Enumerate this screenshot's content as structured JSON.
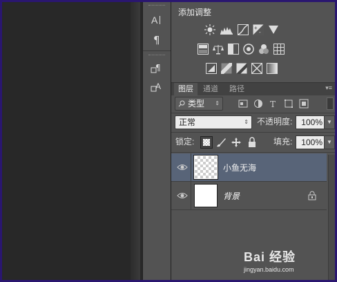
{
  "adjustments": {
    "title": "添加调整",
    "row1": [
      "brightness-icon",
      "levels-icon",
      "curves-icon",
      "exposure-icon",
      "vibrance-icon"
    ],
    "row2": [
      "hue-saturation-icon",
      "color-balance-icon",
      "black-white-icon",
      "photo-filter-icon",
      "channel-mixer-icon",
      "color-lookup-icon"
    ],
    "row3": [
      "invert-icon",
      "posterize-icon",
      "threshold-icon",
      "selective-color-icon",
      "gradient-map-icon"
    ]
  },
  "tabs": [
    {
      "label": "图层",
      "active": true
    },
    {
      "label": "通道",
      "active": false
    },
    {
      "label": "路径",
      "active": false
    }
  ],
  "layers_panel": {
    "filter_label": "类型",
    "blend_mode": "正常",
    "opacity_label": "不透明度:",
    "opacity_value": "100%",
    "lock_label": "锁定:",
    "fill_label": "填充:",
    "fill_value": "100%"
  },
  "layers": [
    {
      "name": "小鱼无海",
      "selected": true,
      "thumb": "transparent",
      "locked": false
    },
    {
      "name": "背景",
      "selected": false,
      "thumb": "white",
      "locked": true
    }
  ],
  "watermark": {
    "line1": "Bai 经验",
    "line2": "jingyan.baidu.com"
  },
  "colors": {
    "frame": "#2a1670",
    "panel": "#535353",
    "canvas": "#282828",
    "selected_row": "#586478"
  }
}
